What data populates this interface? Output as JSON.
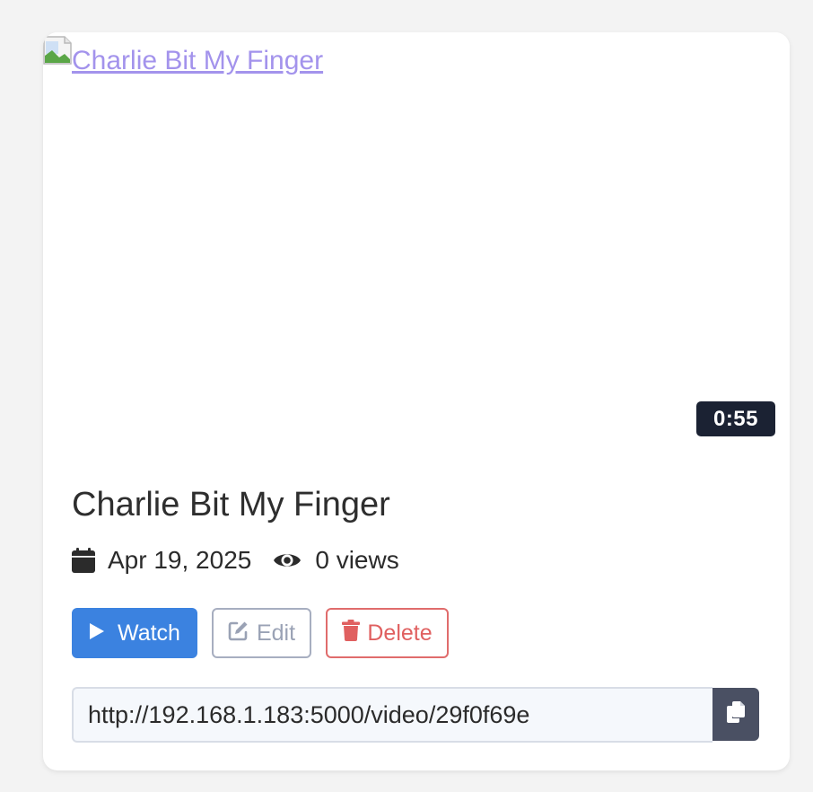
{
  "video": {
    "thumbnail_alt": "Charlie Bit My Finger",
    "duration": "0:55",
    "title": "Charlie Bit My Finger",
    "date": "Apr 19, 2025",
    "views": "0 views"
  },
  "actions": {
    "watch_label": "Watch",
    "edit_label": "Edit",
    "delete_label": "Delete"
  },
  "share": {
    "url": "http://192.168.1.183:5000/video/29f0f69e"
  },
  "icons": {
    "calendar": "calendar-icon",
    "views": "eye-icon",
    "watch": "play-icon",
    "edit": "edit-icon",
    "delete": "trash-icon",
    "copy": "copy-icon",
    "thumbnail": "broken-image-icon"
  },
  "colors": {
    "background": "#f3f3f3",
    "card": "#ffffff",
    "link": "#a393ec",
    "duration_badge": "#1b2233",
    "watch": "#3b82e0",
    "edit": "#a7aec0",
    "delete": "#e06060",
    "copy": "#4a5063"
  }
}
